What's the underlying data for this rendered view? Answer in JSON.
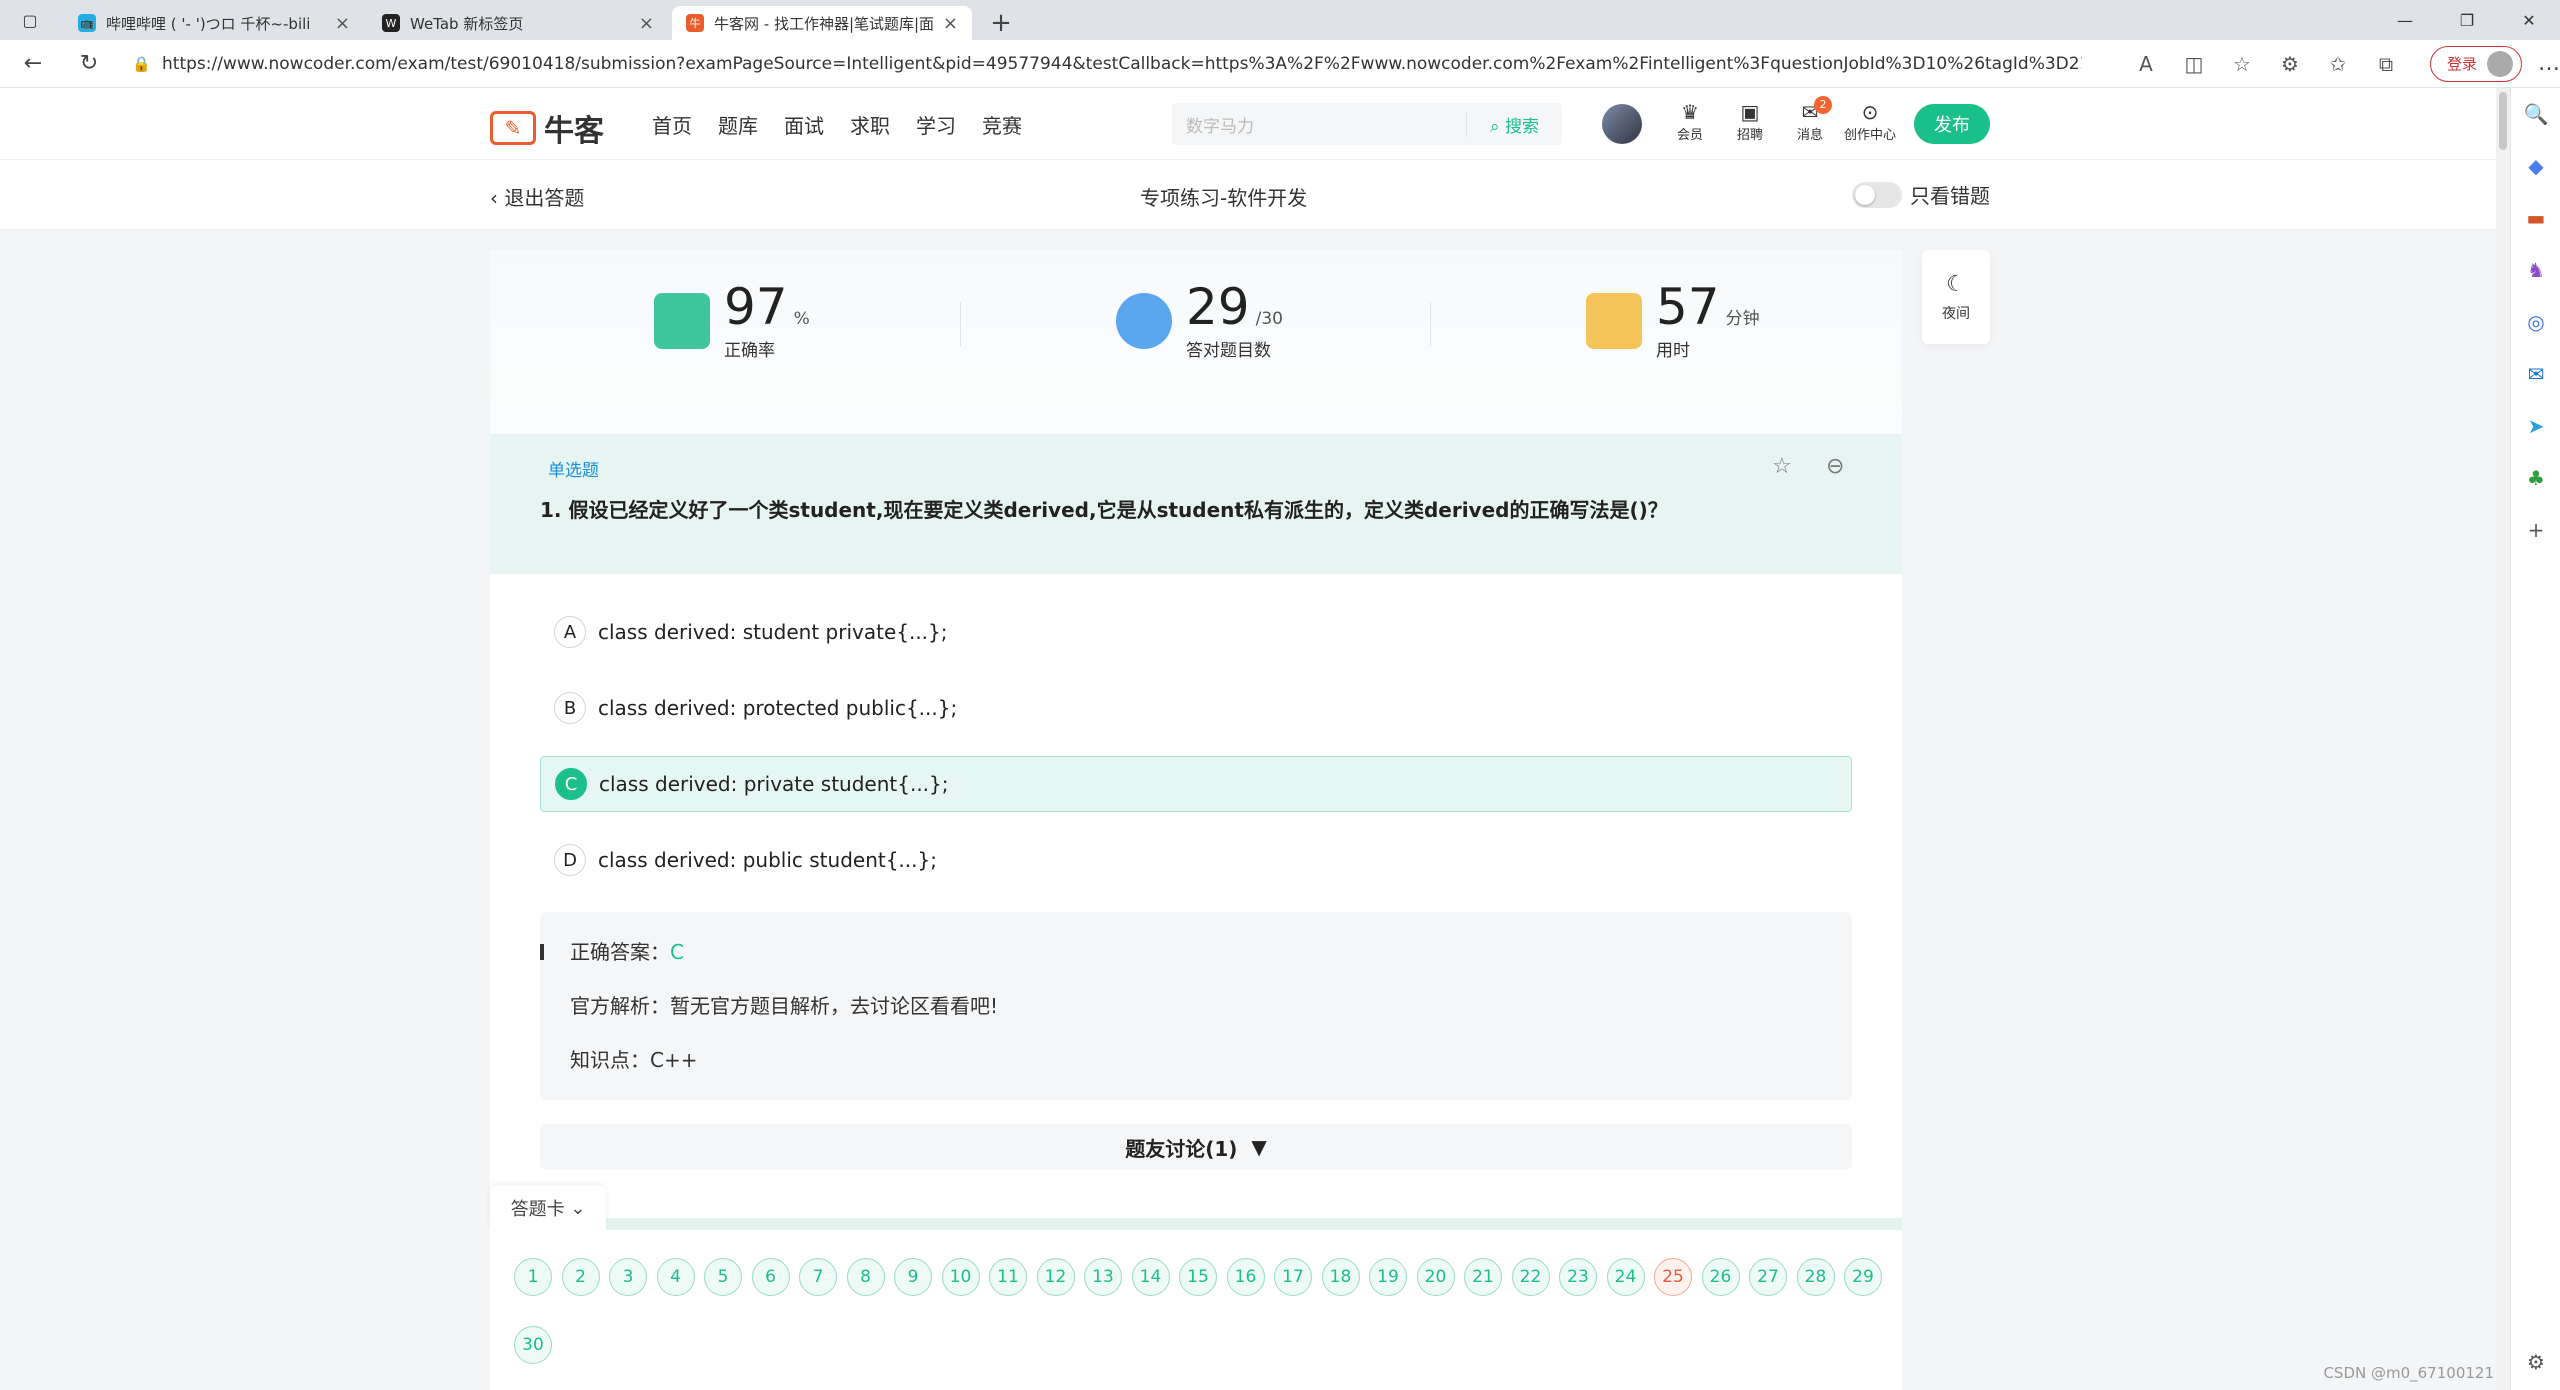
{
  "browser": {
    "tabs": [
      {
        "title": "哔哩哔哩 ( '-  ')つロ 千杯~-bili",
        "favicon_color": "#23ade5",
        "favicon": "📺",
        "active": false
      },
      {
        "title": "WeTab 新标签页",
        "favicon_color": "#222222",
        "favicon": "W",
        "active": false
      },
      {
        "title": "牛客网 - 找工作神器|笔试题库|面",
        "favicon_color": "#ea5c2b",
        "favicon": "牛",
        "active": true
      }
    ],
    "url": "https://www.nowcoder.com/exam/test/69010418/submission?examPageSource=Intelligent&pid=49577944&testCallback=https%3A%2F%2Fwww.nowcoder.com%2Fexam%2Fintelligent%3FquestionJobId%3D10%26tagId%3D21002&testclass=...",
    "login_label": "登录"
  },
  "header": {
    "logo_text": "牛客",
    "nav": [
      "首页",
      "题库",
      "面试",
      "求职",
      "学习",
      "竞赛"
    ],
    "search_placeholder": "数字马力",
    "search_button": "搜索",
    "icons": [
      {
        "label": "会员",
        "glyph": "♛"
      },
      {
        "label": "招聘",
        "glyph": "▣"
      },
      {
        "label": "消息",
        "glyph": "✉",
        "badge": "2"
      },
      {
        "label": "创作中心",
        "glyph": "⊙"
      }
    ],
    "publish": "发布"
  },
  "subheader": {
    "exit": "退出答题",
    "title": "专项练习-软件开发",
    "only_wrong": "只看错题"
  },
  "stats": [
    {
      "num": "97",
      "unit": "%",
      "label": "正确率",
      "color": "#3ec79a"
    },
    {
      "num": "29",
      "unit": "/30",
      "label": "答对题目数",
      "color": "#5aa7f0"
    },
    {
      "num": "57",
      "unit": "分钟",
      "label": "用时",
      "color": "#f4c35a"
    }
  ],
  "question": {
    "type": "单选题",
    "text": "1. 假设已经定义好了一个类student,现在要定义类derived,它是从student私有派生的，定义类derived的正确写法是()？",
    "options": [
      {
        "letter": "A",
        "text": "class derived: student private{...};"
      },
      {
        "letter": "B",
        "text": "class derived: protected public{...};"
      },
      {
        "letter": "C",
        "text": "class derived: private student{...};"
      },
      {
        "letter": "D",
        "text": "class derived: public student{...};"
      }
    ]
  },
  "answer": {
    "correct_label": "正确答案：",
    "correct_value": "C",
    "official": "官方解析：暂无官方题目解析，去讨论区看看吧!",
    "knowledge": "知识点：C++"
  },
  "discussion": "题友讨论(1)",
  "answer_card": {
    "label": "答题卡",
    "numbers": [
      "1",
      "2",
      "3",
      "4",
      "5",
      "6",
      "7",
      "8",
      "9",
      "10",
      "11",
      "12",
      "13",
      "14",
      "15",
      "16",
      "17",
      "18",
      "19",
      "20",
      "21",
      "22",
      "23",
      "24",
      "25",
      "26",
      "27",
      "28",
      "29",
      "30"
    ],
    "wrong": [
      "25"
    ]
  },
  "night_mode": "夜间",
  "watermark": "CSDN @m0_67100121",
  "colors": {
    "accent": "#1bbf8a",
    "wrong": "#e8573a"
  }
}
